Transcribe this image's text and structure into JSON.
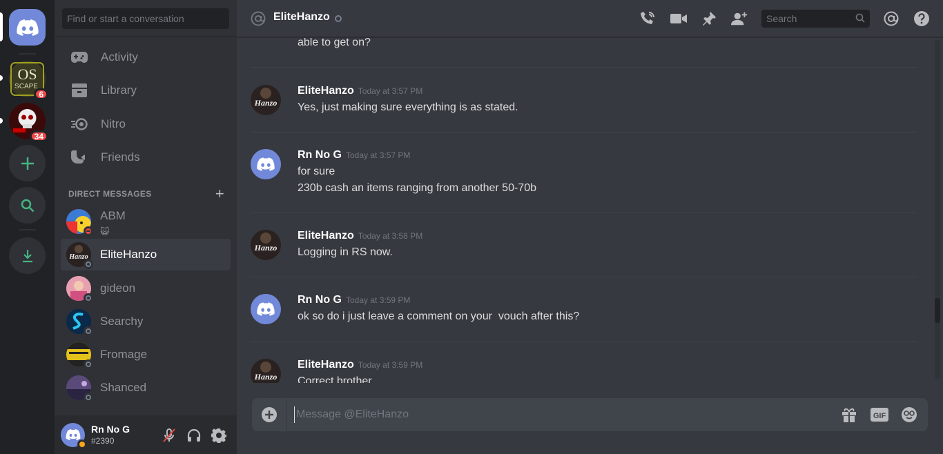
{
  "sidebar": {
    "search_placeholder": "Find or start a conversation",
    "nav": [
      {
        "label": "Activity"
      },
      {
        "label": "Library"
      },
      {
        "label": "Nitro"
      },
      {
        "label": "Friends"
      }
    ],
    "dm_header": "DIRECT MESSAGES",
    "dms": [
      {
        "name": "ABM",
        "status": "dnd",
        "sub": "🙀"
      },
      {
        "name": "EliteHanzo",
        "status": "offline"
      },
      {
        "name": "gideon",
        "status": "offline"
      },
      {
        "name": "Searchy",
        "status": "offline"
      },
      {
        "name": "Fromage",
        "status": "offline"
      },
      {
        "name": "Shanced",
        "status": "offline"
      }
    ]
  },
  "servers": [
    {
      "name": "OS SCAPE",
      "badge": "6"
    },
    {
      "name": "Skull server",
      "badge": "34"
    }
  ],
  "user": {
    "name": "Rn No G",
    "tag": "#2390"
  },
  "channel": {
    "name": "EliteHanzo"
  },
  "search": {
    "placeholder": "Search"
  },
  "messages": {
    "partial_top": "able to get on?",
    "groups": [
      {
        "author": "EliteHanzo",
        "time": "Today at 3:57 PM",
        "lines": [
          "Yes, just making sure everything is as stated."
        ]
      },
      {
        "author": "Rn No G",
        "time": "Today at 3:57 PM",
        "lines": [
          "for sure",
          "230b cash an items ranging from another 50-70b"
        ]
      },
      {
        "author": "EliteHanzo",
        "time": "Today at 3:58 PM",
        "lines": [
          "Logging in RS now."
        ]
      },
      {
        "author": "Rn No G",
        "time": "Today at 3:59 PM",
        "lines": [
          "ok so do i just leave a comment on your  vouch after this?"
        ]
      },
      {
        "author": "EliteHanzo",
        "time": "Today at 3:59 PM",
        "lines": [
          "Correct brother"
        ]
      }
    ]
  },
  "composer": {
    "placeholder": "Message @EliteHanzo",
    "gif_label": "GIF"
  },
  "avatar_text": "Hanzo",
  "colors": {
    "blurple": "#7289da",
    "dnd": "#f04747",
    "idle": "#faa61a",
    "offline": "#747f8d",
    "green": "#43b581"
  }
}
